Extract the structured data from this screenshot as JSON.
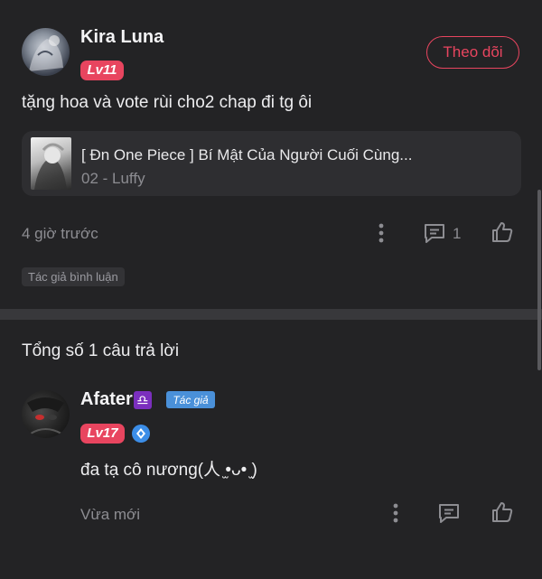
{
  "comment": {
    "username": "Kira Luna",
    "level": "Lv11",
    "follow_label": "Theo dõi",
    "text": "tặng hoa và vote rùi cho2 chap đi tg ôi",
    "linked_story": {
      "title": "[ Đn One Piece ] Bí Mật Của Người Cuối Cùng...",
      "chapter": "02 - Luffy"
    },
    "time": "4 giờ trước",
    "reply_count": "1",
    "tag": "Tác giả bình luận"
  },
  "replies_header": "Tổng số 1 câu trả lời",
  "reply": {
    "username": "Afater",
    "zodiac": "♎",
    "author_badge": "Tác giả",
    "level": "Lv17",
    "text": "đa tạ cô nương(人 ̫•ᴗ• ̫)",
    "time": "Vừa mới"
  },
  "colors": {
    "background": "#232325",
    "accent": "#e8455f",
    "card": "#2e2e31",
    "divider": "#38383b",
    "author_badge": "#4a90d9"
  }
}
